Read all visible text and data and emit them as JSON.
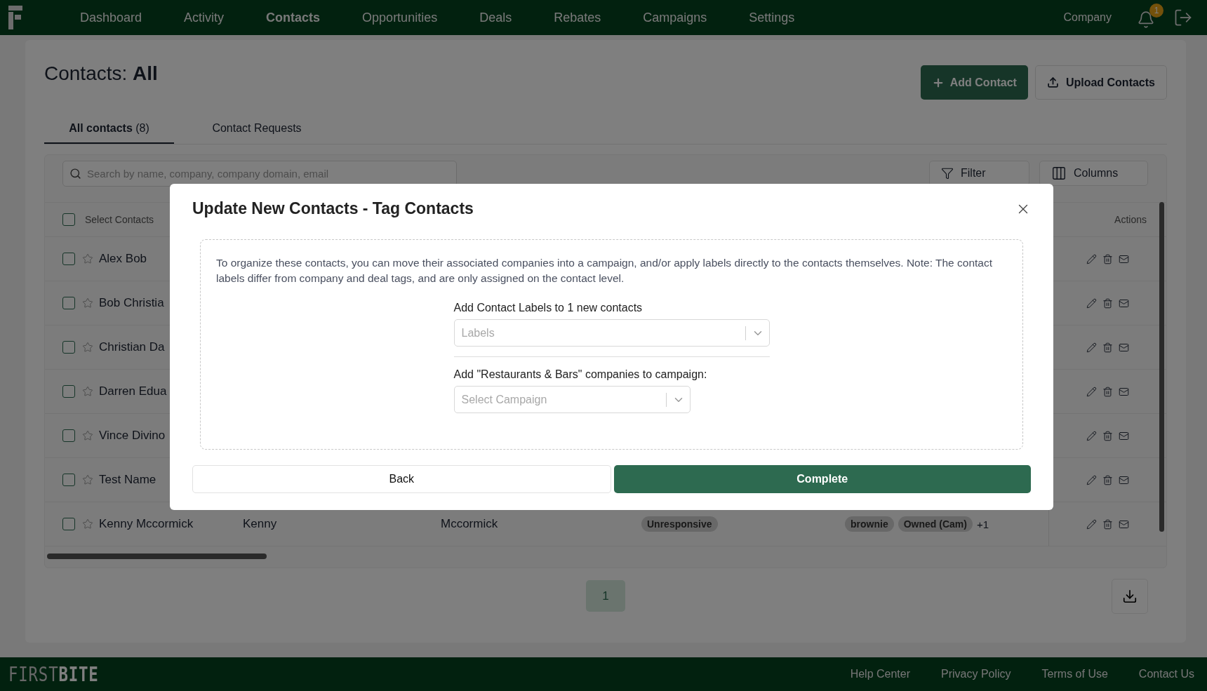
{
  "nav": {
    "items": [
      {
        "label": "Dashboard",
        "selected": false
      },
      {
        "label": "Activity",
        "selected": false
      },
      {
        "label": "Contacts",
        "selected": true
      },
      {
        "label": "Opportunities",
        "selected": false
      },
      {
        "label": "Deals",
        "selected": false
      },
      {
        "label": "Rebates",
        "selected": false
      },
      {
        "label": "Campaigns",
        "selected": false
      },
      {
        "label": "Settings",
        "selected": false
      }
    ],
    "company": "Company",
    "notification_count": "1"
  },
  "page": {
    "title": "Contacts: **All**",
    "add_button": "Add Contact",
    "upload_button": "Upload Contacts"
  },
  "tabs": [
    {
      "label": "All contacts",
      "count": "(8)",
      "selected": true
    },
    {
      "label": "Contact Requests",
      "selected": false
    }
  ],
  "toolbar": {
    "search_placeholder": "Search by name, company, company domain, email",
    "filter_button": "Filter",
    "columns_button": "Columns"
  },
  "table": {
    "select_label": "Select Contacts",
    "select_all_checked": false,
    "actions_label": "Actions",
    "rows": [
      {
        "name": "Alex Bob",
        "checked": false
      },
      {
        "name": "Bob Christia",
        "checked": false
      },
      {
        "name": "Christian Da",
        "checked": false
      },
      {
        "name": "Darren Edua",
        "checked": false
      },
      {
        "name": "Vince Divino",
        "checked": false
      },
      {
        "name": "Test Name",
        "checked": false
      },
      {
        "name": "Kenny Mccormick",
        "first": "Kenny",
        "last": "Mccormick",
        "status": "Unresponsive",
        "tags": [
          "brownie",
          "Owned (Cam)"
        ],
        "more": "+1",
        "checked": false
      }
    ]
  },
  "pagination": [
    {
      "label": "1",
      "selected": true
    }
  ],
  "modal": {
    "title": "Update New Contacts - Tag Contacts",
    "description": "To organize these contacts, you can move their associated companies into a campaign, and/or apply labels directly to the contacts themselves. Note: The contact labels differ from company and deal tags, and are only assigned on the contact level.",
    "labels_field": {
      "label": "Add Contact Labels to 1 new contacts",
      "placeholder": "Labels"
    },
    "campaign_field": {
      "label": "Add \"Restaurants & Bars\" companies to campaign:",
      "placeholder": "Select Campaign"
    },
    "back_button": "Back",
    "complete_button": "Complete"
  },
  "footer": {
    "brand": "FIRST**BITE**",
    "links": [
      "Help Center",
      "Privacy Policy",
      "Terms of Use",
      "Contact Us"
    ]
  }
}
